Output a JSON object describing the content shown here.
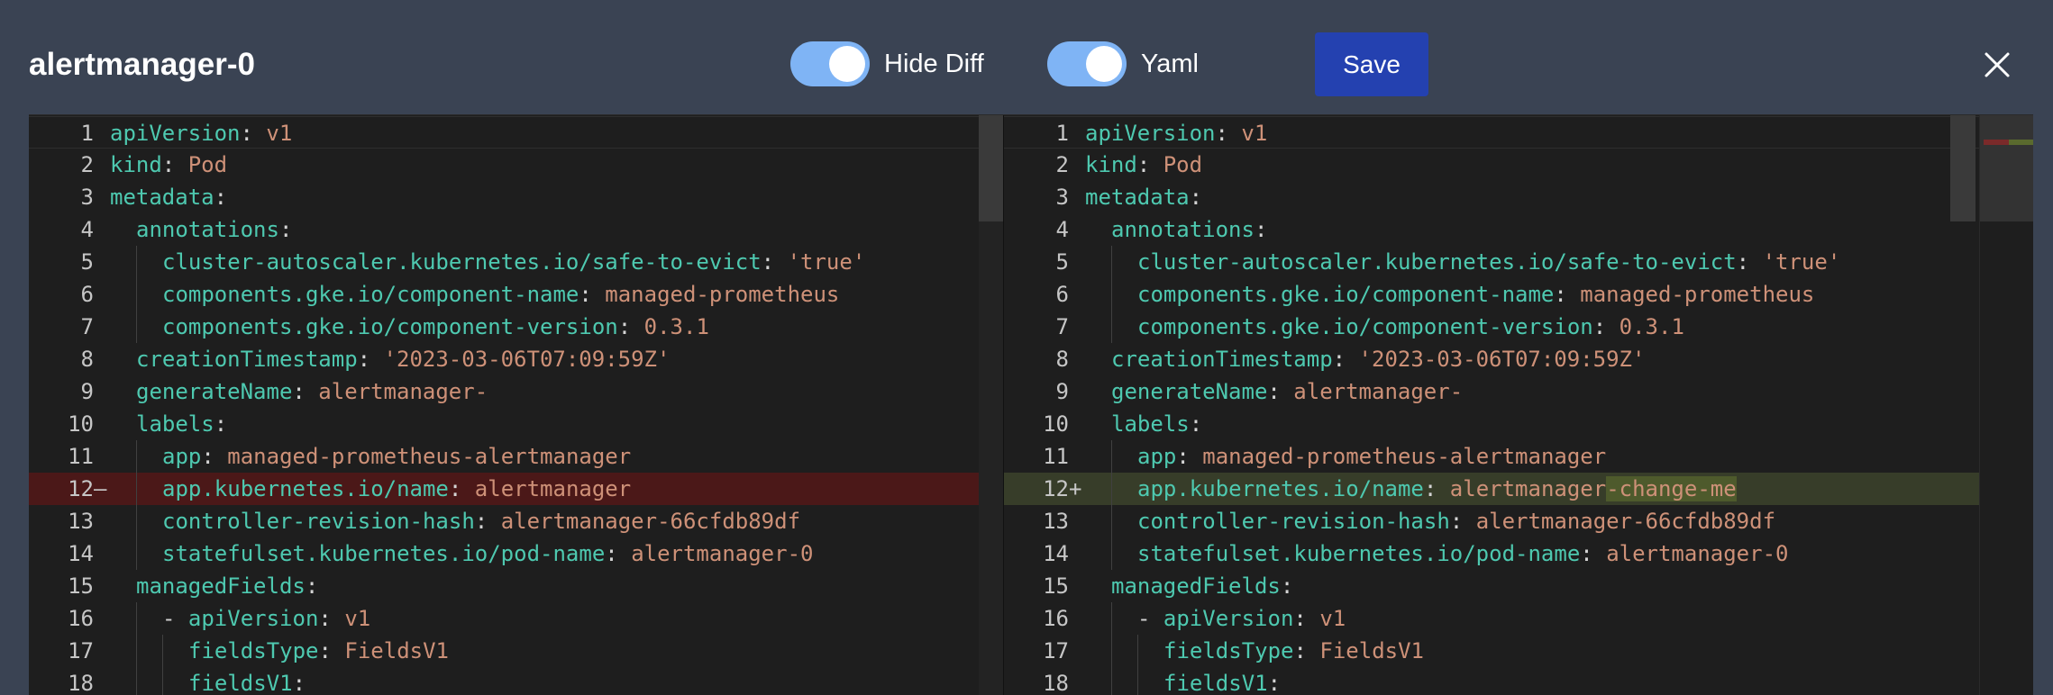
{
  "title": "alertmanager-0",
  "toggles": {
    "hide_diff": {
      "label": "Hide Diff",
      "on": true
    },
    "yaml": {
      "label": "Yaml",
      "on": true
    }
  },
  "save_label": "Save",
  "close_icon": "close-icon",
  "colors": {
    "background": "#3a4353",
    "toggle_on": "#7fb4f5",
    "save_button": "#2441b0",
    "editor_bg": "#1e1e1e",
    "key": "#4ec9b0",
    "value": "#ce9178",
    "removed_line": "#4b1818",
    "added_line": "#373d29"
  },
  "diff": {
    "left": [
      {
        "num": "1",
        "mark": "",
        "indent": 0,
        "key": "apiVersion",
        "sep": ": ",
        "value": "v1"
      },
      {
        "num": "2",
        "mark": "",
        "indent": 0,
        "key": "kind",
        "sep": ": ",
        "value": "Pod"
      },
      {
        "num": "3",
        "mark": "",
        "indent": 0,
        "key": "metadata",
        "sep": ":",
        "value": ""
      },
      {
        "num": "4",
        "mark": "",
        "indent": 1,
        "key": "annotations",
        "sep": ":",
        "value": ""
      },
      {
        "num": "5",
        "mark": "",
        "indent": 2,
        "key": "cluster-autoscaler.kubernetes.io/safe-to-evict",
        "sep": ": ",
        "value": "'true'"
      },
      {
        "num": "6",
        "mark": "",
        "indent": 2,
        "key": "components.gke.io/component-name",
        "sep": ": ",
        "value": "managed-prometheus"
      },
      {
        "num": "7",
        "mark": "",
        "indent": 2,
        "key": "components.gke.io/component-version",
        "sep": ": ",
        "value": "0.3.1"
      },
      {
        "num": "8",
        "mark": "",
        "indent": 1,
        "key": "creationTimestamp",
        "sep": ": ",
        "value": "'2023-03-06T07:09:59Z'"
      },
      {
        "num": "9",
        "mark": "",
        "indent": 1,
        "key": "generateName",
        "sep": ": ",
        "value": "alertmanager-"
      },
      {
        "num": "10",
        "mark": "",
        "indent": 1,
        "key": "labels",
        "sep": ":",
        "value": ""
      },
      {
        "num": "11",
        "mark": "",
        "indent": 2,
        "key": "app",
        "sep": ": ",
        "value": "managed-prometheus-alertmanager"
      },
      {
        "num": "12",
        "mark": "—",
        "indent": 2,
        "key": "app.kubernetes.io/name",
        "sep": ": ",
        "value": "alertmanager",
        "change": "removed"
      },
      {
        "num": "13",
        "mark": "",
        "indent": 2,
        "key": "controller-revision-hash",
        "sep": ": ",
        "value": "alertmanager-66cfdb89df"
      },
      {
        "num": "14",
        "mark": "",
        "indent": 2,
        "key": "statefulset.kubernetes.io/pod-name",
        "sep": ": ",
        "value": "alertmanager-0"
      },
      {
        "num": "15",
        "mark": "",
        "indent": 1,
        "key": "managedFields",
        "sep": ":",
        "value": ""
      },
      {
        "num": "16",
        "mark": "",
        "indent": 2,
        "dash": true,
        "key": "apiVersion",
        "sep": ": ",
        "value": "v1"
      },
      {
        "num": "17",
        "mark": "",
        "indent": 3,
        "key": "fieldsType",
        "sep": ": ",
        "value": "FieldsV1"
      },
      {
        "num": "18",
        "mark": "",
        "indent": 3,
        "key": "fieldsV1",
        "sep": ":",
        "value": ""
      }
    ],
    "right": [
      {
        "num": "1",
        "mark": "",
        "indent": 0,
        "key": "apiVersion",
        "sep": ": ",
        "value": "v1"
      },
      {
        "num": "2",
        "mark": "",
        "indent": 0,
        "key": "kind",
        "sep": ": ",
        "value": "Pod"
      },
      {
        "num": "3",
        "mark": "",
        "indent": 0,
        "key": "metadata",
        "sep": ":",
        "value": ""
      },
      {
        "num": "4",
        "mark": "",
        "indent": 1,
        "key": "annotations",
        "sep": ":",
        "value": ""
      },
      {
        "num": "5",
        "mark": "",
        "indent": 2,
        "key": "cluster-autoscaler.kubernetes.io/safe-to-evict",
        "sep": ": ",
        "value": "'true'"
      },
      {
        "num": "6",
        "mark": "",
        "indent": 2,
        "key": "components.gke.io/component-name",
        "sep": ": ",
        "value": "managed-prometheus"
      },
      {
        "num": "7",
        "mark": "",
        "indent": 2,
        "key": "components.gke.io/component-version",
        "sep": ": ",
        "value": "0.3.1"
      },
      {
        "num": "8",
        "mark": "",
        "indent": 1,
        "key": "creationTimestamp",
        "sep": ": ",
        "value": "'2023-03-06T07:09:59Z'"
      },
      {
        "num": "9",
        "mark": "",
        "indent": 1,
        "key": "generateName",
        "sep": ": ",
        "value": "alertmanager-"
      },
      {
        "num": "10",
        "mark": "",
        "indent": 1,
        "key": "labels",
        "sep": ":",
        "value": ""
      },
      {
        "num": "11",
        "mark": "",
        "indent": 2,
        "key": "app",
        "sep": ": ",
        "value": "managed-prometheus-alertmanager"
      },
      {
        "num": "12",
        "mark": "+",
        "indent": 2,
        "key": "app.kubernetes.io/name",
        "sep": ": ",
        "value": "alertmanager",
        "value_added": "-change-me",
        "change": "added"
      },
      {
        "num": "13",
        "mark": "",
        "indent": 2,
        "key": "controller-revision-hash",
        "sep": ": ",
        "value": "alertmanager-66cfdb89df"
      },
      {
        "num": "14",
        "mark": "",
        "indent": 2,
        "key": "statefulset.kubernetes.io/pod-name",
        "sep": ": ",
        "value": "alertmanager-0"
      },
      {
        "num": "15",
        "mark": "",
        "indent": 1,
        "key": "managedFields",
        "sep": ":",
        "value": ""
      },
      {
        "num": "16",
        "mark": "",
        "indent": 2,
        "dash": true,
        "key": "apiVersion",
        "sep": ": ",
        "value": "v1"
      },
      {
        "num": "17",
        "mark": "",
        "indent": 3,
        "key": "fieldsType",
        "sep": ": ",
        "value": "FieldsV1"
      },
      {
        "num": "18",
        "mark": "",
        "indent": 3,
        "key": "fieldsV1",
        "sep": ":",
        "value": ""
      }
    ]
  }
}
